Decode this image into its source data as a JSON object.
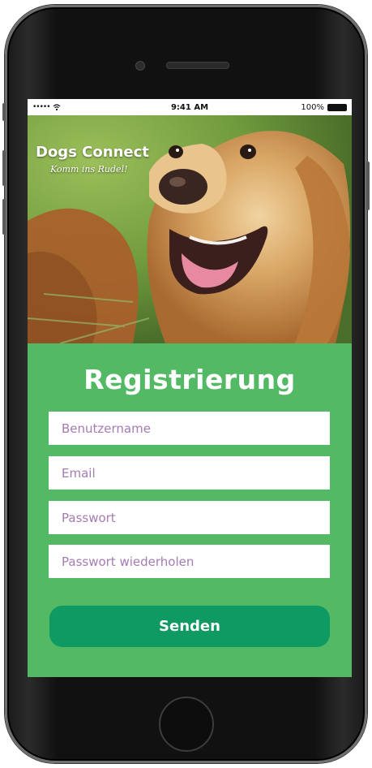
{
  "status_bar": {
    "signal": "•••••",
    "wifi": "wifi-icon",
    "time": "9:41 AM",
    "battery_pct": "100%"
  },
  "hero": {
    "brand_title": "Dogs Connect",
    "brand_subtitle": "Komm ins Rudel!"
  },
  "form": {
    "title": "Registrierung",
    "fields": [
      {
        "placeholder": "Benutzername",
        "value": ""
      },
      {
        "placeholder": "Email",
        "value": ""
      },
      {
        "placeholder": "Passwort",
        "value": ""
      },
      {
        "placeholder": "Passwort wiederholen",
        "value": ""
      }
    ],
    "submit_label": "Senden"
  },
  "colors": {
    "screen_green": "#54b964",
    "button_green": "#0f9a63",
    "placeholder_purple": "#a57bb3"
  }
}
